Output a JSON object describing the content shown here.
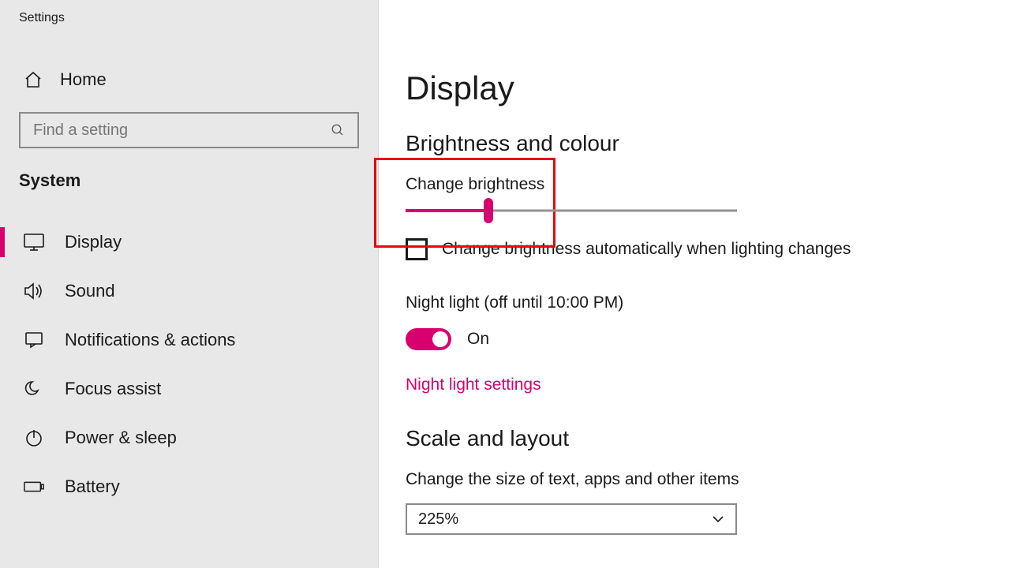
{
  "app_title": "Settings",
  "sidebar": {
    "home_label": "Home",
    "search_placeholder": "Find a setting",
    "section_label": "System",
    "items": [
      {
        "label": "Display",
        "icon": "monitor-icon",
        "active": true
      },
      {
        "label": "Sound",
        "icon": "speaker-icon",
        "active": false
      },
      {
        "label": "Notifications & actions",
        "icon": "notification-icon",
        "active": false
      },
      {
        "label": "Focus assist",
        "icon": "moon-icon",
        "active": false
      },
      {
        "label": "Power & sleep",
        "icon": "power-icon",
        "active": false
      },
      {
        "label": "Battery",
        "icon": "battery-icon",
        "active": false
      }
    ]
  },
  "main": {
    "page_title": "Display",
    "brightness_section": "Brightness and colour",
    "change_brightness_label": "Change brightness",
    "brightness_percent": 25,
    "auto_brightness_label": "Change brightness automatically when lighting changes",
    "auto_brightness_checked": false,
    "night_light_label": "Night light (off until 10:00 PM)",
    "night_light_on": true,
    "night_light_state_text": "On",
    "night_light_settings_link": "Night light settings",
    "scale_section": "Scale and layout",
    "scale_label": "Change the size of text, apps and other items",
    "scale_value": "225%"
  },
  "colors": {
    "accent": "#d8006f"
  }
}
